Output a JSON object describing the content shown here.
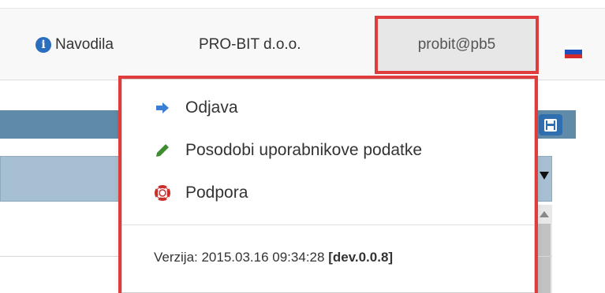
{
  "navbar": {
    "help_label": "Navodila",
    "company_label": "PRO-BIT d.o.o.",
    "user_label": "probit@pb5"
  },
  "user_menu": {
    "items": [
      {
        "label": "Odjava",
        "icon": "sign-out-icon"
      },
      {
        "label": "Posodobi uporabnikove podatke",
        "icon": "pencil-icon"
      },
      {
        "label": "Podpora",
        "icon": "life-ring-icon"
      }
    ],
    "version_prefix": "Verzija: 2015.03.16 09:34:28 ",
    "version_build": "[dev.0.0.8]"
  },
  "colors": {
    "highlight_border": "#e03c3c",
    "accent": "#2f6fb0",
    "panel_header": "#5f8aa8",
    "logout_icon": "#3a7fd5",
    "edit_icon": "#3e8e2f",
    "support_icon": "#c9302c"
  }
}
